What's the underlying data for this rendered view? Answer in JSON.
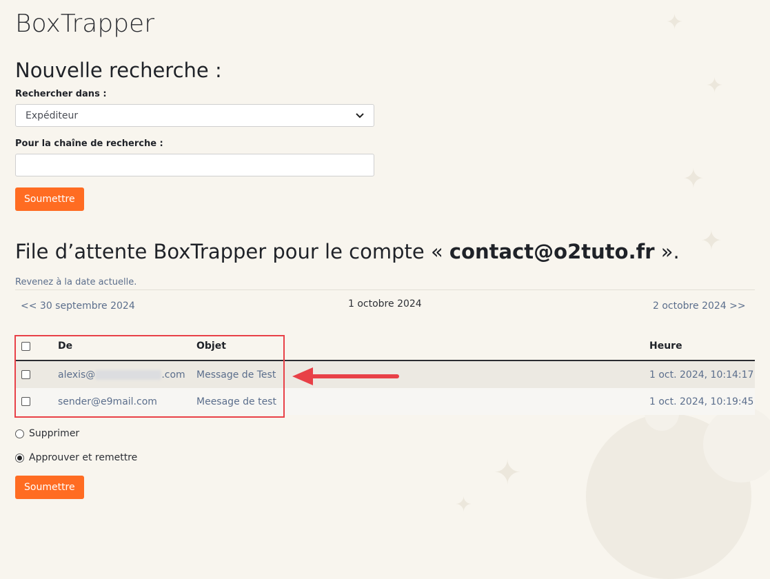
{
  "app": {
    "title": "BoxTrapper"
  },
  "search": {
    "heading": "Nouvelle recherche :",
    "search_in_label": "Rechercher dans :",
    "search_in_value": "Expéditeur",
    "query_label": "Pour la chaîne de recherche :",
    "query_value": "",
    "submit_label": "Soumettre"
  },
  "queue": {
    "title_prefix": "File d’attente BoxTrapper pour le compte « ",
    "account": "contact@o2tuto.fr",
    "title_suffix": " ».",
    "back_to_today": "Revenez à la date actuelle.",
    "prev_date": "<< 30 septembre 2024",
    "current_date": "1 octobre 2024",
    "next_date": "2 octobre 2024 >>",
    "columns": {
      "from": "De",
      "subject": "Objet",
      "time": "Heure"
    },
    "rows": [
      {
        "from_user": "alexis@",
        "from_domain_suffix": ".com",
        "subject": "Message de Test",
        "time": "1 oct. 2024, 10:14:17"
      },
      {
        "from": "sender@e9mail.com",
        "subject": "Meesage de test",
        "time": "1 oct. 2024, 10:19:45"
      }
    ]
  },
  "actions": {
    "delete_label": "Supprimer",
    "approve_label": "Approuver et remettre",
    "selected": "approve",
    "submit_label": "Soumettre"
  },
  "colors": {
    "accent": "#ff6c22",
    "highlight": "#e84047",
    "link": "#5b6e8c",
    "background": "#f8f5ee"
  }
}
